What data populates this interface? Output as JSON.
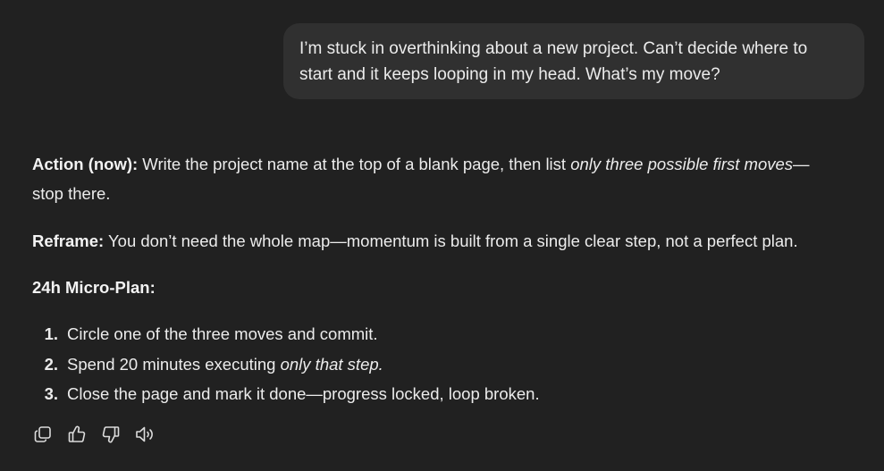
{
  "user_message": {
    "line1": "I’m stuck in overthinking about a new project. Can’t decide where to",
    "line2": "start and it keeps looping in my head. What’s my move?"
  },
  "assistant": {
    "action": {
      "label": "Action (now):",
      "text_before": " Write the project name at the top of a blank page, then list ",
      "italic": "only three possible first moves",
      "text_after": "—",
      "line2": "stop there."
    },
    "reframe": {
      "label": "Reframe:",
      "text": " You don’t need the whole map—momentum is built from a single clear step, not a perfect plan."
    },
    "plan_heading": "24h Micro-Plan:",
    "plan_items": [
      {
        "num": "1.",
        "text": "Circle one of the three moves and commit.",
        "italic": "",
        "after": ""
      },
      {
        "num": "2.",
        "text": "Spend 20 minutes executing ",
        "italic": "only that step.",
        "after": ""
      },
      {
        "num": "3.",
        "text": "Close the page and mark it done—progress locked, loop broken.",
        "italic": "",
        "after": ""
      }
    ]
  },
  "action_icons": [
    "copy-icon",
    "thumbs-up-icon",
    "thumbs-down-icon",
    "read-aloud-icon"
  ],
  "colors": {
    "background": "#212121",
    "user_bubble": "#303030",
    "text": "#ececec"
  }
}
